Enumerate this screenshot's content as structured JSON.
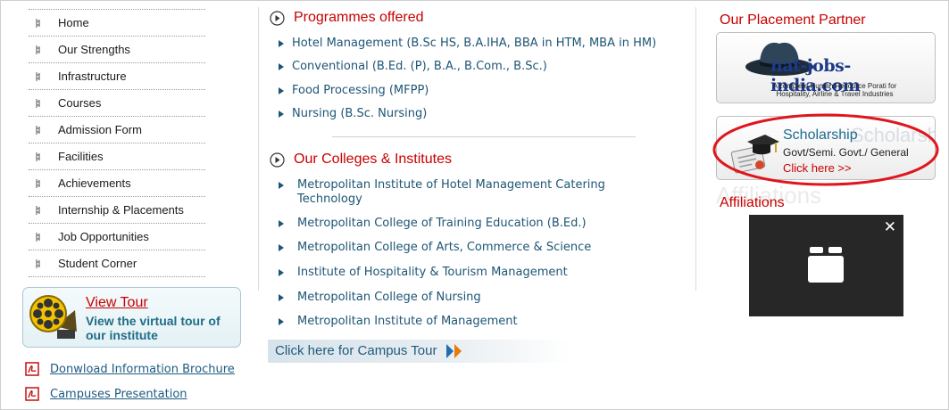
{
  "nav": {
    "items": [
      {
        "label": "Home"
      },
      {
        "label": "Our Strengths"
      },
      {
        "label": "Infrastructure"
      },
      {
        "label": "Courses"
      },
      {
        "label": "Admission Form"
      },
      {
        "label": "Facilities"
      },
      {
        "label": "Achievements"
      },
      {
        "label": "Internship & Placements"
      },
      {
        "label": "Job Opportunities"
      },
      {
        "label": "Student Corner"
      }
    ]
  },
  "tour": {
    "title": "View Tour",
    "subtitle": "View the virtual tour of our institute"
  },
  "downloads": [
    {
      "label": "Donwload Information Brochure",
      "icon": "pdf-icon"
    },
    {
      "label": "Campuses Presentation",
      "icon": "pdf-icon"
    }
  ],
  "programmes": {
    "heading": "Programmes offered",
    "items": [
      "Hotel Management (B.Sc HS, B.A.IHA, BBA in HTM, MBA in HM)",
      "Conventional (B.Ed. (P), B.A., B.Com., B.Sc.)",
      "Food Processing (MFPP)",
      "Nursing (B.Sc. Nursing)"
    ]
  },
  "colleges": {
    "heading": "Our Colleges & Institutes",
    "items": [
      "Metropolitan Institute of Hotel Management Catering Technology",
      "Metropolitan College of Training Education (B.Ed.)",
      "Metropolitan College of Arts, Commerce & Science",
      "Institute of Hospitality & Tourism Management",
      "Metropolitan College of Nursing",
      "Metropolitan Institute of Management"
    ]
  },
  "campus_tour": {
    "label": "Click here for Campus Tour"
  },
  "placement": {
    "heading": "Our Placement Partner",
    "logo_text": "nat-jobs-india.com",
    "tagline": "A complete Human Resource Porati for Hospitality, Airline & Travel Industries"
  },
  "scholarship": {
    "title": "Scholarship",
    "ghost": "Scholarship",
    "subtitle": "Govt/Semi. Govt./ General",
    "link": "Click here >>"
  },
  "affiliations": {
    "heading": "Affiliations",
    "ghost": "Affiliations"
  },
  "popup": {
    "close": "✕",
    "icon": "gallery-icon"
  },
  "colors": {
    "accent_red": "#c80000",
    "link_blue": "#1d5575",
    "highlight": "#e0151d"
  }
}
